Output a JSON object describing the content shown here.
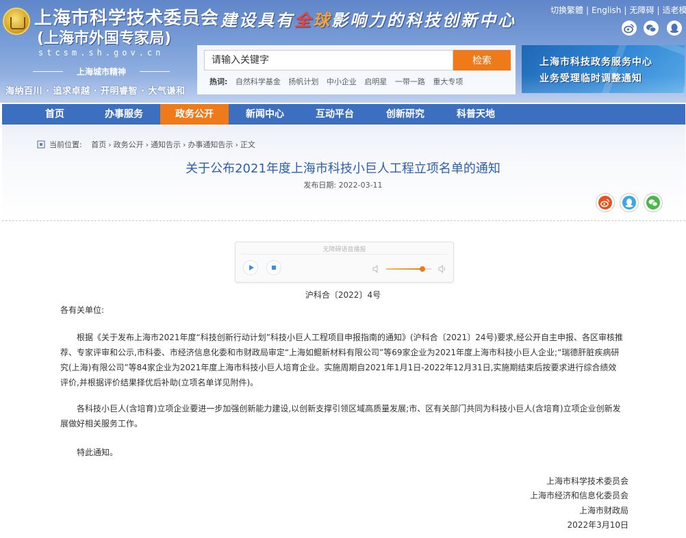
{
  "header": {
    "logo_title": "上海市科学技术委员会",
    "logo_sub": "(上海市外国专家局)",
    "domain": "stcsm.sh.gov.cn",
    "spirit_label": "上海城市精神",
    "spirit_text": "海纳百川 · 追求卓越 · 开明睿智 · 大气谦和",
    "slogan_pre": "建设具有",
    "slogan_hl1": "全",
    "slogan_hl2": "球",
    "slogan_post": "影响力的科技创新中心",
    "top_links": [
      "切换繁體",
      "English",
      "无障碍",
      "适老模式"
    ],
    "share_icons": [
      "weibo-icon",
      "wechat-icon",
      "qq-icon"
    ]
  },
  "search": {
    "placeholder": "请输入关键字",
    "button_label": "检索",
    "hot_label": "热词:",
    "hot_words": [
      "自然科学基金",
      "扬帆计划",
      "中小企业",
      "启明星",
      "一带一路",
      "重大专项"
    ]
  },
  "banner": {
    "line1": "上海市科技政务服务中心",
    "line2": "业务受理临时调整通知"
  },
  "nav": {
    "items": [
      "首页",
      "办事服务",
      "政务公开",
      "新闻中心",
      "互动平台",
      "创新研究",
      "科普天地"
    ],
    "active_index": 2
  },
  "breadcrumb": {
    "label": "当前位置:",
    "items": [
      "首页",
      "政务公开",
      "通知告示",
      "办事通知告示",
      "正文"
    ]
  },
  "article": {
    "title": "关于公布2021年度上海市科技小巨人工程立项名单的通知",
    "pub_date": "发布日期: 2022-03-11",
    "doc_number": "沪科合〔2022〕4号",
    "salutation": "各有关单位:",
    "paragraphs": [
      "根据《关于发布上海市2021年度“科技创新行动计划”科技小巨人工程项目申报指南的通知》(沪科合〔2021〕24号)要求,经公开自主申报、各区审核推荐、专家评审和公示,市科委、市经济信息化委和市财政局审定“上海如鲲新材料有限公司”等69家企业为2021年度上海市科技小巨人企业;“瑞德肝脏疾病研究(上海)有限公司”等84家企业为2021年度上海市科技小巨人培育企业。实施周期自2021年1月1日-2022年12月31日,实施期结束后按要求进行综合绩效评价,并根据评价结果择优后补助(立项名单详见附件)。",
      "各科技小巨人(含培育)立项企业要进一步加强创新能力建设,以创新支撑引领区域高质量发展;市、区有关部门共同为科技小巨人(含培育)立项企业创新发展做好相关服务工作。",
      "特此通知。"
    ],
    "signatures": [
      "上海市科学技术委员会",
      "上海市经济和信息化委员会",
      "上海市财政局",
      "2022年3月10日"
    ]
  },
  "player": {
    "label": "无障碍语音播报",
    "volume": 0.8
  },
  "colors": {
    "nav_bg": "#3d6fc0",
    "accent_orange": "#ee7a1a",
    "title_blue": "#2b5fb0"
  }
}
